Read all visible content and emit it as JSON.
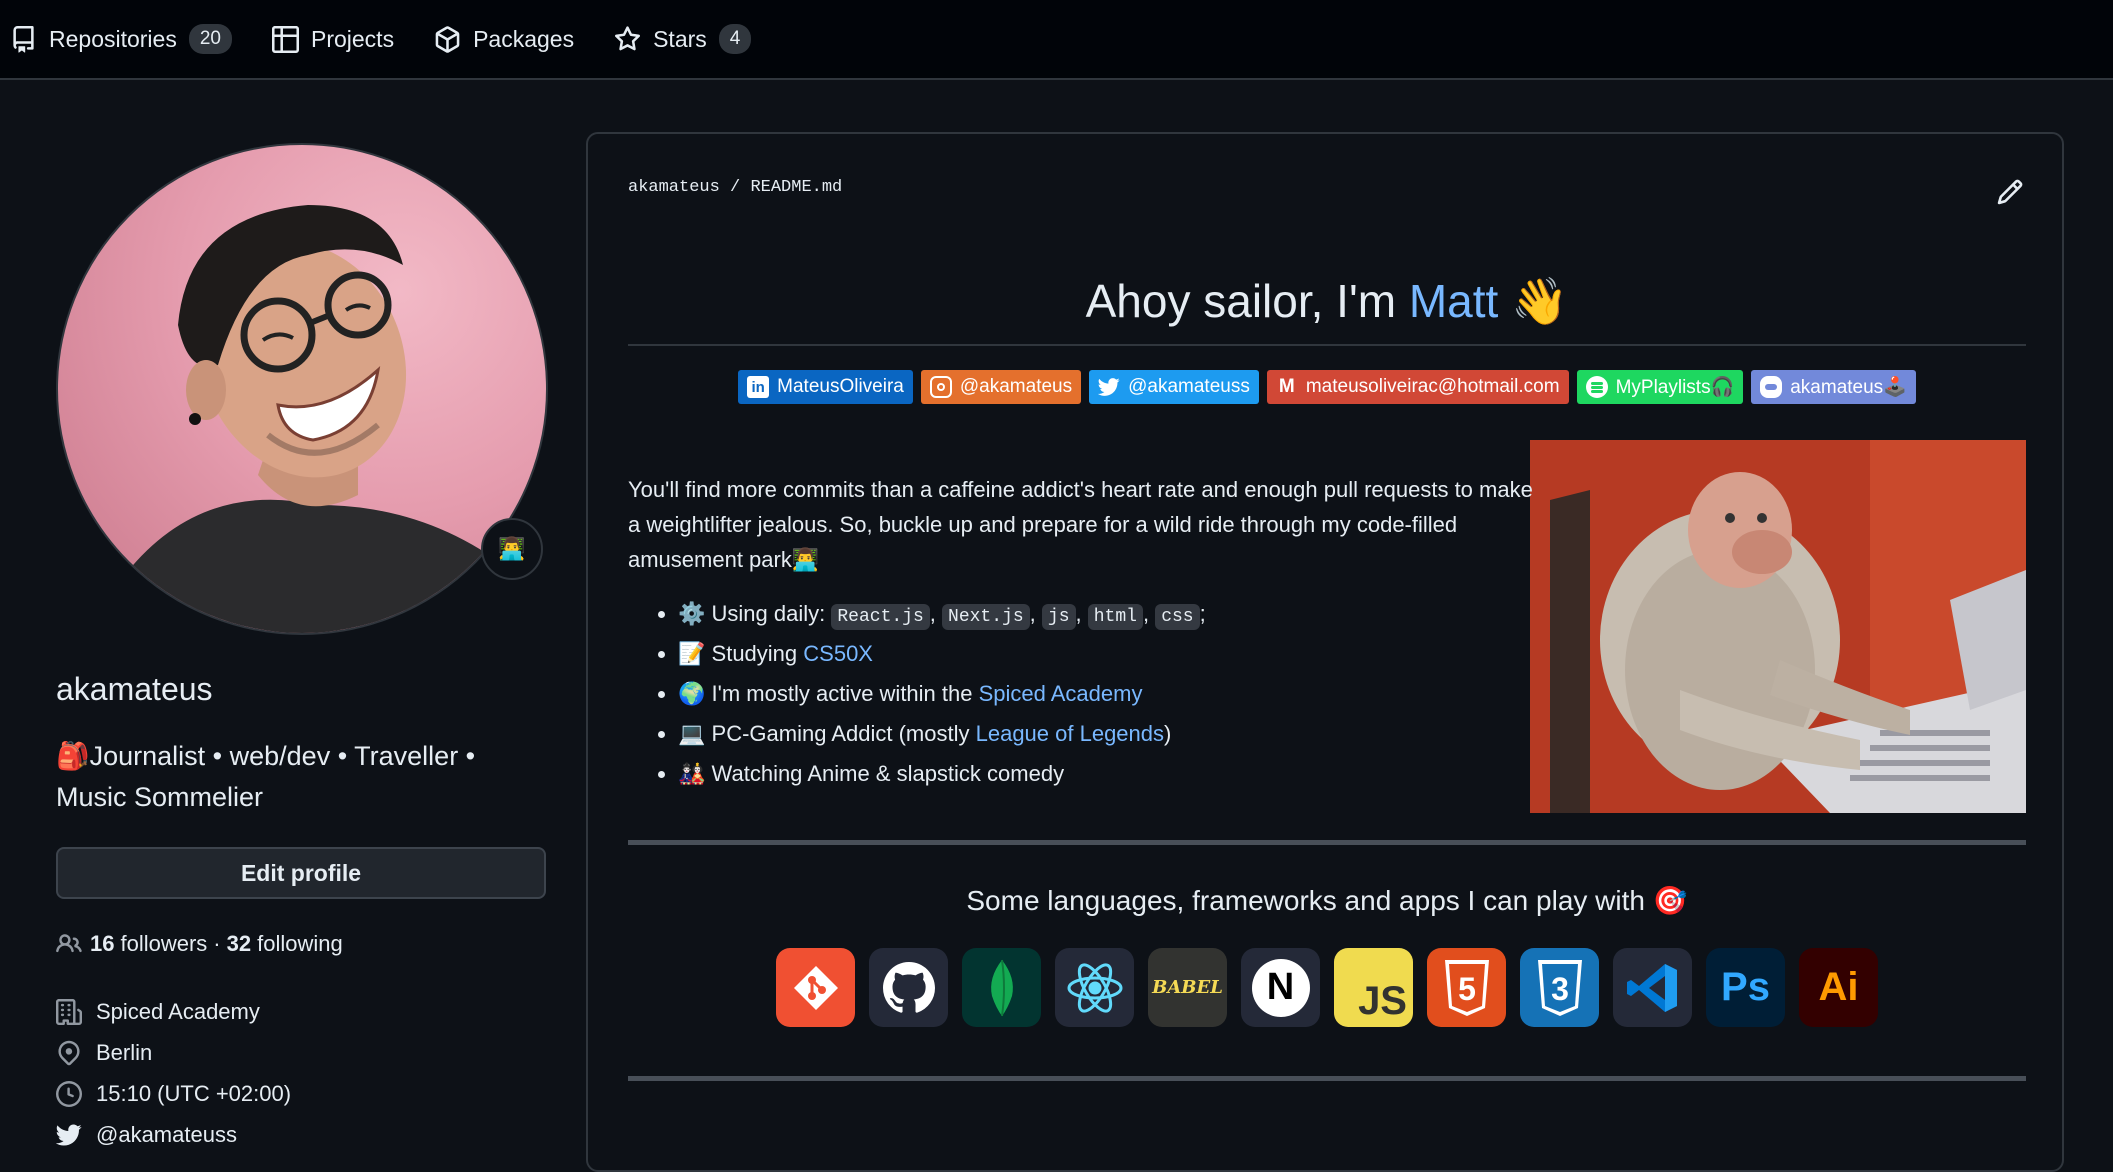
{
  "nav": {
    "tabs": [
      {
        "label": "Repositories",
        "count": "20",
        "icon": "repo-icon"
      },
      {
        "label": "Projects",
        "icon": "table-icon"
      },
      {
        "label": "Packages",
        "icon": "package-icon"
      },
      {
        "label": "Stars",
        "count": "4",
        "icon": "star-icon"
      }
    ]
  },
  "profile": {
    "username": "akamateus",
    "status_emoji": "👨‍💻",
    "bio_emoji": "🎒",
    "bio": "Journalist • web/dev • Traveller • Music Sommelier",
    "edit_label": "Edit profile",
    "followers_count": "16",
    "followers_label": "followers",
    "separator": "·",
    "following_count": "32",
    "following_label": "following",
    "company": "Spiced Academy",
    "location": "Berlin",
    "time": "15:10 (UTC +02:00)",
    "twitter": "@akamateuss"
  },
  "readme": {
    "path_user": "akamateus",
    "path_sep": " / ",
    "path_file": "README.md",
    "title_prefix": "Ahoy sailor, I'm ",
    "title_name": "Matt",
    "title_emoji": "👋",
    "badges": [
      {
        "label": "MateusOliveira",
        "icon": "linkedin-icon",
        "color": "#0a66c2"
      },
      {
        "label": "@akamateus",
        "icon": "instagram-icon",
        "color": "#e4702d"
      },
      {
        "label": "@akamateuss",
        "icon": "twitter-icon",
        "color": "#1d9bf0"
      },
      {
        "label": "mateusoliveirac@hotmail.com",
        "icon": "gmail-icon",
        "color": "#d14836"
      },
      {
        "label": "MyPlaylists🎧",
        "icon": "spotify-icon",
        "color": "#1ed760"
      },
      {
        "label": "akamateus🕹️",
        "icon": "discord-icon",
        "color": "#7289da"
      }
    ],
    "intro_text": "You'll find more commits than a caffeine addict's heart rate and enough pull requests to make a weightlifter jealous. So, buckle up and prepare for a wild ride through my code-filled amusement park👨‍💻",
    "list": {
      "daily_emoji": "⚙️",
      "daily_label": "Using daily: ",
      "daily_tools": [
        "React.js",
        "Next.js",
        "js",
        "html",
        "css"
      ],
      "daily_end": ";",
      "studying_emoji": "📝",
      "studying_label": "Studying ",
      "studying_link": "CS50X",
      "active_emoji": "🌍",
      "active_label": "I'm mostly active within the ",
      "active_link": "Spiced Academy",
      "gaming_emoji": "💻",
      "gaming_label": "PC-Gaming Addict (mostly ",
      "gaming_link": "League of Legends",
      "gaming_end": ")",
      "anime_emoji": "🎎",
      "anime_label": "Watching Anime & slapstick comedy"
    },
    "langs_title": "Some languages, frameworks and apps I can play with",
    "langs_emoji": "🎯",
    "tech_icons": [
      {
        "name": "git-icon",
        "bg": "#f05032"
      },
      {
        "name": "github-icon",
        "bg": "#242938"
      },
      {
        "name": "mongodb-icon",
        "bg": "#023430"
      },
      {
        "name": "react-icon",
        "bg": "#242938"
      },
      {
        "name": "babel-icon",
        "bg": "#323330",
        "text": "BABEL"
      },
      {
        "name": "nextjs-icon",
        "bg": "#242938",
        "text": "N"
      },
      {
        "name": "javascript-icon",
        "bg": "#f0db4f",
        "text": "JS"
      },
      {
        "name": "html5-icon",
        "bg": "#e14e1d",
        "text": "5"
      },
      {
        "name": "css3-icon",
        "bg": "#1572b6",
        "text": "3"
      },
      {
        "name": "vscode-icon",
        "bg": "#242938"
      },
      {
        "name": "photoshop-icon",
        "bg": "#001e36",
        "text": "Ps"
      },
      {
        "name": "illustrator-icon",
        "bg": "#330000",
        "text": "Ai"
      }
    ]
  }
}
